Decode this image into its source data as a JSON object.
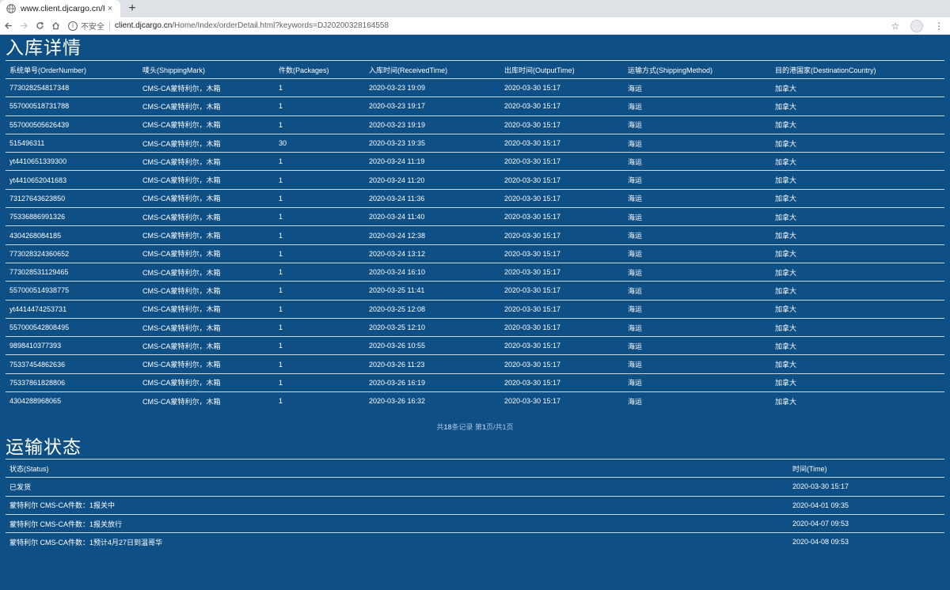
{
  "browser": {
    "tab_title": "www.client.djcargo.cn/Home/I",
    "tab_close": "×",
    "new_tab": "+",
    "security_label": "不安全",
    "url_host": "client.djcargo.cn",
    "url_path": "/Home/Index/orderDetail.html?keywords=DJ20200328164558"
  },
  "receipt": {
    "title": "入库详情",
    "columns": [
      "系统单号(OrderNumber)",
      "唛头(ShippingMark)",
      "件数(Packages)",
      "入库时间(ReceivedTime)",
      "出库时间(OutputTime)",
      "运输方式(ShippingMethod)",
      "目的港国家(DestinationCountry)"
    ],
    "rows": [
      [
        "773028254817348",
        "CMS-CA蒙特利尔，木箱",
        "1",
        "2020-03-23 19:09",
        "2020-03-30 15:17",
        "海运",
        "加拿大"
      ],
      [
        "557000518731788",
        "CMS-CA蒙特利尔，木箱",
        "1",
        "2020-03-23 19:17",
        "2020-03-30 15:17",
        "海运",
        "加拿大"
      ],
      [
        "557000505626439",
        "CMS-CA蒙特利尔，木箱",
        "1",
        "2020-03-23 19:19",
        "2020-03-30 15:17",
        "海运",
        "加拿大"
      ],
      [
        "515496311",
        "CMS-CA蒙特利尔，木箱",
        "30",
        "2020-03-23 19:35",
        "2020-03-30 15:17",
        "海运",
        "加拿大"
      ],
      [
        "yt4410651339300",
        "CMS-CA蒙特利尔，木箱",
        "1",
        "2020-03-24 11:19",
        "2020-03-30 15:17",
        "海运",
        "加拿大"
      ],
      [
        "yt4410652041683",
        "CMS-CA蒙特利尔，木箱",
        "1",
        "2020-03-24 11:20",
        "2020-03-30 15:17",
        "海运",
        "加拿大"
      ],
      [
        "73127643623850",
        "CMS-CA蒙特利尔，木箱",
        "1",
        "2020-03-24 11:36",
        "2020-03-30 15:17",
        "海运",
        "加拿大"
      ],
      [
        "75336886991326",
        "CMS-CA蒙特利尔，木箱",
        "1",
        "2020-03-24 11:40",
        "2020-03-30 15:17",
        "海运",
        "加拿大"
      ],
      [
        "4304268084185",
        "CMS-CA蒙特利尔，木箱",
        "1",
        "2020-03-24 12:38",
        "2020-03-30 15:17",
        "海运",
        "加拿大"
      ],
      [
        "773028324360652",
        "CMS-CA蒙特利尔，木箱",
        "1",
        "2020-03-24 13:12",
        "2020-03-30 15:17",
        "海运",
        "加拿大"
      ],
      [
        "773028531129465",
        "CMS-CA蒙特利尔，木箱",
        "1",
        "2020-03-24 16:10",
        "2020-03-30 15:17",
        "海运",
        "加拿大"
      ],
      [
        "557000514938775",
        "CMS-CA蒙特利尔，木箱",
        "1",
        "2020-03-25 11:41",
        "2020-03-30 15:17",
        "海运",
        "加拿大"
      ],
      [
        "yt4414474253731",
        "CMS-CA蒙特利尔，木箱",
        "1",
        "2020-03-25 12:08",
        "2020-03-30 15:17",
        "海运",
        "加拿大"
      ],
      [
        "557000542808495",
        "CMS-CA蒙特利尔，木箱",
        "1",
        "2020-03-25 12:10",
        "2020-03-30 15:17",
        "海运",
        "加拿大"
      ],
      [
        "9898410377393",
        "CMS-CA蒙特利尔，木箱",
        "1",
        "2020-03-26 10:55",
        "2020-03-30 15:17",
        "海运",
        "加拿大"
      ],
      [
        "75337454862636",
        "CMS-CA蒙特利尔，木箱",
        "1",
        "2020-03-26 11:23",
        "2020-03-30 15:17",
        "海运",
        "加拿大"
      ],
      [
        "75337861828806",
        "CMS-CA蒙特利尔，木箱",
        "1",
        "2020-03-26 16:19",
        "2020-03-30 15:17",
        "海运",
        "加拿大"
      ],
      [
        "4304288968065",
        "CMS-CA蒙特利尔，木箱",
        "1",
        "2020-03-26 16:32",
        "2020-03-30 15:17",
        "海运",
        "加拿大"
      ]
    ],
    "pager": {
      "prefix": "共",
      "total": "18",
      "mid": "条记录 第",
      "page": "1",
      "suffix": "页/共1页"
    }
  },
  "transport": {
    "title": "运输状态",
    "columns": [
      "状态(Status)",
      "时间(Time)"
    ],
    "rows": [
      [
        "已发货",
        "2020-03-30 15:17"
      ],
      [
        "蒙特利尔 CMS-CA件数：1报关中",
        "2020-04-01 09:35"
      ],
      [
        "蒙特利尔 CMS-CA件数：1报关放行",
        "2020-04-07 09:53"
      ],
      [
        "蒙特利尔 CMS-CA件数：1预计4月27日到温哥华",
        "2020-04-08 09:53"
      ]
    ]
  }
}
